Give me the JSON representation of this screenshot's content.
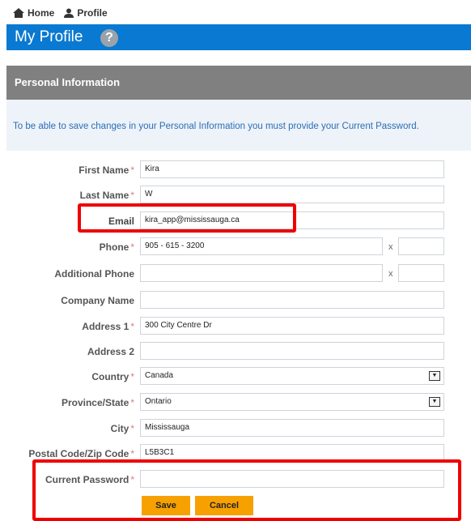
{
  "breadcrumb": {
    "home": "Home",
    "profile": "Profile"
  },
  "page": {
    "title": "My Profile",
    "help": "?"
  },
  "section": {
    "title": "Personal Information"
  },
  "notice": "To be able to save changes in your Personal Information you must provide your Current Password.",
  "required_mark": "*",
  "ext_separator": "x",
  "form": {
    "first_name": {
      "label": "First Name",
      "value": "Kira"
    },
    "last_name": {
      "label": "Last Name",
      "value": "W"
    },
    "email": {
      "label": "Email",
      "value": "kira_app@mississauga.ca"
    },
    "phone": {
      "label": "Phone",
      "value": "905 - 615 - 3200"
    },
    "additional_phone": {
      "label": "Additional Phone",
      "value": ""
    },
    "company_name": {
      "label": "Company Name",
      "value": ""
    },
    "address1": {
      "label": "Address 1",
      "value": "300 City Centre Dr"
    },
    "address2": {
      "label": "Address 2",
      "value": ""
    },
    "country": {
      "label": "Country",
      "value": "Canada"
    },
    "province": {
      "label": "Province/State",
      "value": "Ontario"
    },
    "city": {
      "label": "City",
      "value": "Mississauga"
    },
    "postal": {
      "label": "Postal Code/Zip Code",
      "value": "L5B3C1"
    },
    "current_password": {
      "label": "Current Password",
      "value": ""
    }
  },
  "buttons": {
    "save": "Save",
    "cancel": "Cancel"
  },
  "colors": {
    "title_bar": "#0a79d1",
    "section_header": "#808080",
    "button": "#f7a100",
    "highlight": "#ee0000"
  }
}
